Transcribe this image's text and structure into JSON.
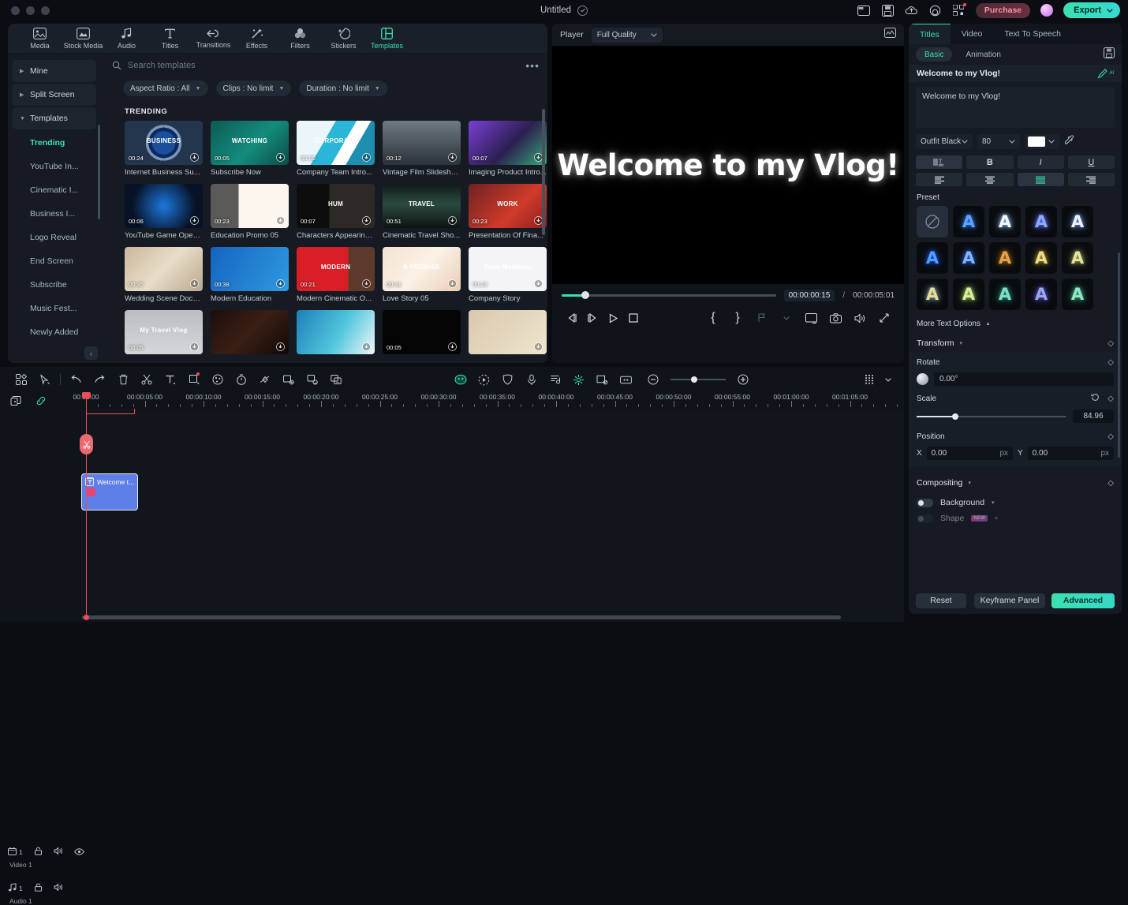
{
  "titlebar": {
    "doc_title": "Untitled",
    "purchase_label": "Purchase",
    "export_label": "Export",
    "icons": [
      "layout-icon",
      "save-icon",
      "cloud-upload-icon",
      "help-icon",
      "qrcode-icon"
    ]
  },
  "nav": {
    "items": [
      {
        "label": "Media",
        "icon": "media-icon",
        "active": false
      },
      {
        "label": "Stock Media",
        "icon": "stock-media-icon",
        "active": false
      },
      {
        "label": "Audio",
        "icon": "audio-note-icon",
        "active": false
      },
      {
        "label": "Titles",
        "icon": "titles-text-icon",
        "active": false
      },
      {
        "label": "Transitions",
        "icon": "transitions-icon",
        "active": false
      },
      {
        "label": "Effects",
        "icon": "effects-wand-icon",
        "active": false
      },
      {
        "label": "Filters",
        "icon": "filters-circles-icon",
        "active": false
      },
      {
        "label": "Stickers",
        "icon": "stickers-icon",
        "active": false
      },
      {
        "label": "Templates",
        "icon": "templates-grid-icon",
        "active": true
      }
    ]
  },
  "sidebar": {
    "groups": [
      {
        "label": "Mine",
        "expanded": false
      },
      {
        "label": "Split Screen",
        "expanded": false
      },
      {
        "label": "Templates",
        "expanded": true
      }
    ],
    "items": [
      {
        "label": "Trending",
        "active": true
      },
      {
        "label": "YouTube In...",
        "active": false
      },
      {
        "label": "Cinematic I...",
        "active": false
      },
      {
        "label": "Business I...",
        "active": false
      },
      {
        "label": "Logo Reveal",
        "active": false
      },
      {
        "label": "End Screen",
        "active": false
      },
      {
        "label": "Subscribe",
        "active": false
      },
      {
        "label": "Music Fest...",
        "active": false
      },
      {
        "label": "Newly Added",
        "active": false
      }
    ]
  },
  "search": {
    "placeholder": "Search templates",
    "value": ""
  },
  "filters": [
    {
      "label": "Aspect Ratio : All"
    },
    {
      "label": "Clips : No limit"
    },
    {
      "label": "Duration : No limit"
    }
  ],
  "templates": {
    "section_label": "TRENDING",
    "items": [
      {
        "name": "Internet Business Su...",
        "duration": "00:24",
        "art": "th-business",
        "overlay": "BUSINESS"
      },
      {
        "name": "Subscribe Now",
        "duration": "00:05",
        "art": "th-watch",
        "overlay": "WATCHING"
      },
      {
        "name": "Company Team Intro...",
        "duration": "00:50",
        "art": "th-corp",
        "overlay": "CORPORATE"
      },
      {
        "name": "Vintage Film Slidesho...",
        "duration": "00:12",
        "art": "th-vintage",
        "overlay": ""
      },
      {
        "name": "Imaging Product Intro...",
        "duration": "00:07",
        "art": "th-imaging",
        "overlay": ""
      },
      {
        "name": "YouTube Game Open...",
        "duration": "00:06",
        "art": "th-game",
        "overlay": ""
      },
      {
        "name": "Education Promo 05",
        "duration": "00:23",
        "art": "th-edu",
        "overlay": ""
      },
      {
        "name": "Characters Appearing...",
        "duration": "00:07",
        "art": "th-hunmell",
        "overlay": "HUM"
      },
      {
        "name": "Cinematic Travel Sho...",
        "duration": "00:51",
        "art": "th-travel",
        "overlay": "TRAVEL"
      },
      {
        "name": "Presentation Of Fina...",
        "duration": "00:23",
        "art": "th-finance",
        "overlay": "WORK"
      },
      {
        "name": "Wedding Scene Docu...",
        "duration": "00:35",
        "art": "th-wedding",
        "overlay": ""
      },
      {
        "name": "Modern Education",
        "duration": "00:38",
        "art": "th-modedu",
        "overlay": ""
      },
      {
        "name": "Modern Cinematic O...",
        "duration": "00:21",
        "art": "th-modcine",
        "overlay": "MODERN"
      },
      {
        "name": "Love Story 05",
        "duration": "00:31",
        "art": "th-love",
        "overlay": "A PROMISE"
      },
      {
        "name": "Company Story",
        "duration": "00:23",
        "art": "th-company",
        "overlay": "Team Members"
      },
      {
        "name": "",
        "duration": "00:05",
        "art": "th-mytravel",
        "overlay": "My Travel Vlog"
      },
      {
        "name": "",
        "duration": "",
        "art": "th-dark1",
        "overlay": ""
      },
      {
        "name": "",
        "duration": "",
        "art": "th-biz2",
        "overlay": ""
      },
      {
        "name": "",
        "duration": "00:05",
        "art": "th-black",
        "overlay": ""
      },
      {
        "name": "",
        "duration": "",
        "art": "th-photos",
        "overlay": ""
      }
    ]
  },
  "player": {
    "label": "Player",
    "quality": "Full Quality",
    "stage_text": "Welcome to my Vlog!",
    "current_time": "00:00:00:15",
    "separator": "/",
    "total_time": "00:00:05:01",
    "scrub_percent": 11,
    "transport": [
      "prev-frame-icon",
      "next-frame-icon",
      "play-icon",
      "stop-icon"
    ],
    "right_tools": [
      "mark-in-brace-icon",
      "mark-out-brace-icon",
      "marker-icon",
      "fullscreen-screen-icon",
      "snapshot-camera-icon",
      "volume-icon",
      "expand-arrow-icon"
    ]
  },
  "right_panel": {
    "tabs": [
      {
        "label": "Titles",
        "active": true
      },
      {
        "label": "Video",
        "active": false
      },
      {
        "label": "Text To Speech",
        "active": false
      }
    ],
    "subtabs": [
      {
        "label": "Basic",
        "active": true
      },
      {
        "label": "Animation",
        "active": false
      }
    ],
    "title_name": "Welcome to my Vlog!",
    "text_value": "Welcome to my Vlog!",
    "font_family": "Outfit Black",
    "font_size": "80",
    "font_color": "#ffffff",
    "style_buttons": [
      {
        "name": "spacing-icon",
        "label": "T",
        "active": true
      },
      {
        "name": "bold-button",
        "label": "B",
        "active": false
      },
      {
        "name": "italic-button",
        "label": "I",
        "active": false
      },
      {
        "name": "underline-button",
        "label": "U",
        "active": false
      }
    ],
    "align_buttons": [
      {
        "name": "align-left-button",
        "active": false
      },
      {
        "name": "align-center-button",
        "active": false
      },
      {
        "name": "align-justify-button",
        "active": true
      },
      {
        "name": "align-right-button",
        "active": false
      }
    ],
    "preset_label": "Preset",
    "presets": [
      {
        "name": "none",
        "color": "",
        "glow": ""
      },
      {
        "name": "preset-1",
        "color": "#5aa4ff",
        "glow": "#2e6fd0"
      },
      {
        "name": "preset-2",
        "color": "#f0f6ff",
        "glow": "#8fb8e8"
      },
      {
        "name": "preset-3",
        "color": "#8ea8ff",
        "glow": "#5a6fe0"
      },
      {
        "name": "preset-4",
        "color": "#eaf2ff",
        "glow": "#6f8fd0"
      },
      {
        "name": "preset-5",
        "color": "#4f9dff",
        "glow": "#1d4fd0"
      },
      {
        "name": "preset-6",
        "color": "#7fb6ff",
        "glow": "#2c5fc0"
      },
      {
        "name": "preset-7",
        "color": "#e8a34a",
        "glow": "#9c6a1e"
      },
      {
        "name": "preset-8",
        "color": "#f0dc8a",
        "glow": "#a08c30"
      },
      {
        "name": "preset-9",
        "color": "#e8e49a",
        "glow": "#8fa060"
      },
      {
        "name": "preset-10",
        "color": "#e9dd90",
        "glow": "#7fa0b0"
      },
      {
        "name": "preset-11",
        "color": "#ddeb9a",
        "glow": "#8fc060"
      },
      {
        "name": "preset-12",
        "color": "#7fe0c8",
        "glow": "#2f9080"
      },
      {
        "name": "preset-13",
        "color": "#9aa8ee",
        "glow": "#5a4fc0"
      },
      {
        "name": "preset-14",
        "color": "#8fe8bf",
        "glow": "#3fa080"
      }
    ],
    "more_text_options": "More Text Options",
    "transform_label": "Transform",
    "rotate_label": "Rotate",
    "rotate_value": "0.00°",
    "scale_label": "Scale",
    "scale_value": "84.96",
    "position_label": "Position",
    "pos_x_label": "X",
    "pos_x_value": "0.00",
    "pos_x_unit": "px",
    "pos_y_label": "Y",
    "pos_y_value": "0.00",
    "pos_y_unit": "px",
    "compositing_label": "Compositing",
    "background_label": "Background",
    "shape_label": "Shape",
    "shape_badge": "NEW",
    "reset_label": "Reset",
    "keyframe_label": "Keyframe Panel",
    "advanced_label": "Advanced"
  },
  "timeline": {
    "tools_left": [
      "grid-view-icon",
      "select-cursor-icon",
      "undo-icon",
      "redo-icon",
      "delete-trash-icon",
      "split-scissors-icon",
      "add-text-icon",
      "crop-icon",
      "color-palette-icon",
      "speed-timer-icon",
      "keyframe-diamond-icon",
      "green-screen-icon",
      "audio-detach-icon",
      "auto-caption-icon"
    ],
    "tools_center": [
      "ai-smart-icon",
      "motion-tracking-icon",
      "mask-shield-icon",
      "voiceover-mic-icon",
      "audio-ducking-icon",
      "render-preview-icon",
      "picture-in-picture-icon",
      "marker-add-icon"
    ],
    "zoom_out": "-",
    "zoom_in": "+",
    "ruler_labels": [
      "00:00:00",
      "00:00:05:00",
      "00:00:10:00",
      "00:00:15:00",
      "00:00:20:00",
      "00:00:25:00",
      "00:00:30:00",
      "00:00:35:00",
      "00:00:40:00",
      "00:00:45:00",
      "00:00:50:00",
      "00:00:55:00",
      "00:01:00:00",
      "00:01:05:00"
    ],
    "tracks": [
      {
        "name": "Video 1",
        "count": "1",
        "icon": "video-track-icon",
        "eye": true
      },
      {
        "name": "Audio 1",
        "count": "1",
        "icon": "audio-track-icon",
        "eye": false
      }
    ],
    "clip_label": "Welcome t..."
  },
  "colors": {
    "accent": "#3ae0b0",
    "playhead": "#ef4d56",
    "clip": "#5f7fe8",
    "purchase": "#ff8fa8"
  }
}
